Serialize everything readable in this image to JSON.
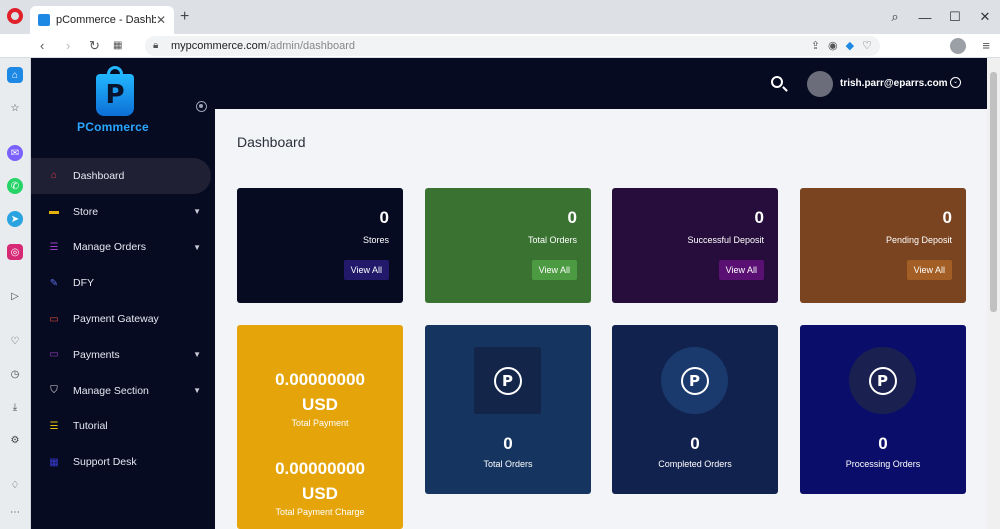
{
  "browser": {
    "tab_title": "pCommerce - Dashboard",
    "url_domain": "mypcommerce.com",
    "url_path": "/admin/dashboard"
  },
  "app": {
    "brand": "PCommerce",
    "user_email": "trish.parr@eparrs.com"
  },
  "sidebar": {
    "items": [
      {
        "label": "Dashboard",
        "icon": "home-icon",
        "color": "#e0394b",
        "active": true,
        "has_children": false
      },
      {
        "label": "Store",
        "icon": "store-icon",
        "color": "#e5b00a",
        "has_children": true
      },
      {
        "label": "Manage Orders",
        "icon": "list-icon",
        "color": "#a13ec9",
        "has_children": true
      },
      {
        "label": "DFY",
        "icon": "pen-icon",
        "color": "#5a6ee8",
        "has_children": false
      },
      {
        "label": "Payment Gateway",
        "icon": "wallet-icon",
        "color": "#e24a3b",
        "has_children": false
      },
      {
        "label": "Payments",
        "icon": "card-icon",
        "color": "#9b3dc3",
        "has_children": true
      },
      {
        "label": "Manage Section",
        "icon": "shield-icon",
        "color": "#e0e0e0",
        "has_children": true
      },
      {
        "label": "Tutorial",
        "icon": "list-icon",
        "color": "#e5c20a",
        "has_children": false
      },
      {
        "label": "Support Desk",
        "icon": "grid-icon",
        "color": "#3a3ad0",
        "has_children": false
      }
    ]
  },
  "main": {
    "title": "Dashboard",
    "top_cards": [
      {
        "value": "0",
        "label": "Stores",
        "button": "View All",
        "bg": "#070b22",
        "btn_bg": "#22196b"
      },
      {
        "value": "0",
        "label": "Total Orders",
        "button": "View All",
        "bg": "#3a7232",
        "btn_bg": "#4c9a42"
      },
      {
        "value": "0",
        "label": "Successful Deposit",
        "button": "View All",
        "bg": "#260d3b",
        "btn_bg": "#5a1072"
      },
      {
        "value": "0",
        "label": "Pending Deposit",
        "button": "View All",
        "bg": "#7b4420",
        "btn_bg": "#a25e24"
      }
    ],
    "money_card": {
      "amount1": "0.00000000",
      "currency1": "USD",
      "label1": "Total Payment",
      "amount2": "0.00000000",
      "currency2": "USD",
      "label2": "Total Payment Charge",
      "bg": "#e5a50a"
    },
    "stat_cards": [
      {
        "value": "0",
        "label": "Total Orders",
        "bg": "#153460",
        "box_bg": "#13264a",
        "shape": "square"
      },
      {
        "value": "0",
        "label": "Completed Orders",
        "bg": "#12224e",
        "box_bg": "#1a3a6e",
        "shape": "circle"
      },
      {
        "value": "0",
        "label": "Processing Orders",
        "bg": "#0a0d6a",
        "box_bg": "#1a2150",
        "shape": "circle"
      }
    ]
  }
}
